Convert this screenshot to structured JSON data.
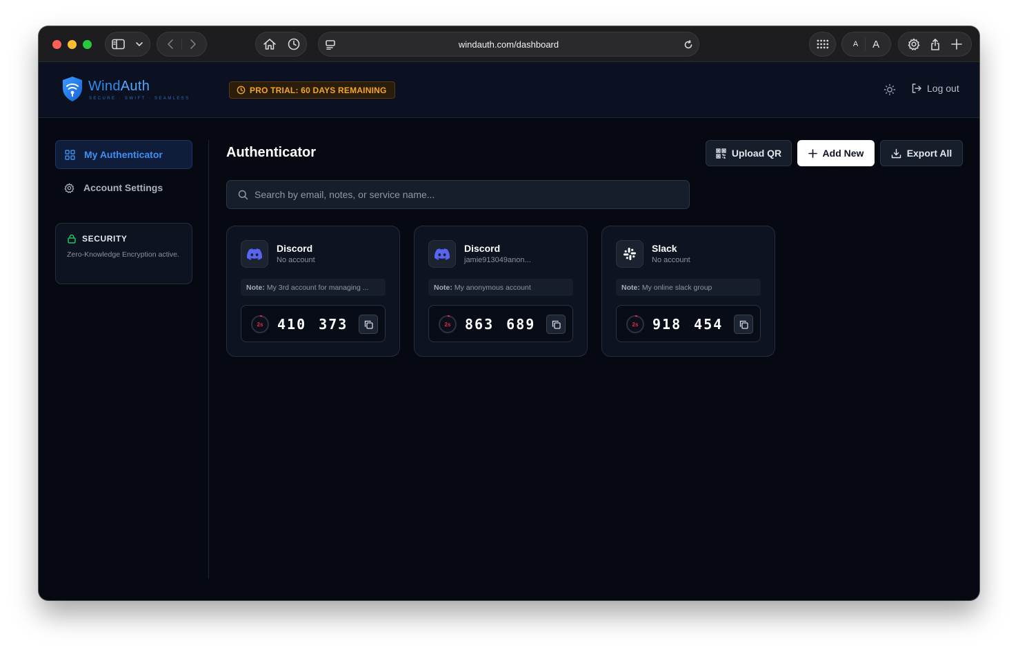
{
  "browser": {
    "url": "windauth.com/dashboard",
    "text_size_small": "A",
    "text_size_large": "A"
  },
  "header": {
    "logo_wind": "Wind",
    "logo_auth": "Auth",
    "tagline": "SECURE · SWIFT · SEAMLESS",
    "trial_badge": "PRO TRIAL: 60 DAYS REMAINING",
    "logout_label": "Log out"
  },
  "sidebar": {
    "items": [
      {
        "label": "My Authenticator",
        "icon": "grid-icon",
        "active": true
      },
      {
        "label": "Account Settings",
        "icon": "gear-icon",
        "active": false
      }
    ],
    "security": {
      "title": "SECURITY",
      "description": "Zero-Knowledge Encryption active."
    }
  },
  "main": {
    "title": "Authenticator",
    "upload_label": "Upload QR",
    "add_label": "Add New",
    "export_label": "Export All",
    "search_placeholder": "Search by email, notes, or service name...",
    "note_prefix": "Note:",
    "cards": [
      {
        "service": "Discord",
        "account": "No account",
        "note": "My 3rd account for managing ...",
        "timer": "2s",
        "code": "410 373",
        "icon": "discord-icon"
      },
      {
        "service": "Discord",
        "account": "jamie913049anon...",
        "note": "My anonymous account",
        "timer": "2s",
        "code": "863 689",
        "icon": "discord-icon"
      },
      {
        "service": "Slack",
        "account": "No account",
        "note": "My online slack group",
        "timer": "2s",
        "code": "918 454",
        "icon": "slack-icon"
      }
    ]
  },
  "colors": {
    "accent": "#3f8ff2",
    "trial": "#f5a623",
    "timer": "#e0294a",
    "discord": "#5865f2",
    "security_lock": "#22c55e"
  }
}
